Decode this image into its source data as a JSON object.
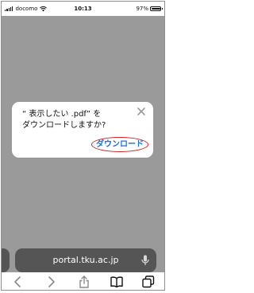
{
  "status_bar": {
    "carrier": "docomo",
    "time": "10:13",
    "battery_percent": "97%"
  },
  "dialog": {
    "message": "“ 表示したい .pdf” を\nダウンロードしますか?",
    "download_label": "ダウンロード",
    "close_icon": "close-icon"
  },
  "address_bar": {
    "url": "portal.tku.ac.jp"
  },
  "toolbar": {
    "icons": [
      "back-arrow-icon",
      "forward-arrow-icon",
      "share-icon",
      "bookmarks-icon",
      "tabs-icon"
    ]
  },
  "colors": {
    "page_dim": "#9a9a9a",
    "link_blue": "#1b6fe0",
    "highlight_red": "#d82020",
    "address_bar": "#555555"
  }
}
